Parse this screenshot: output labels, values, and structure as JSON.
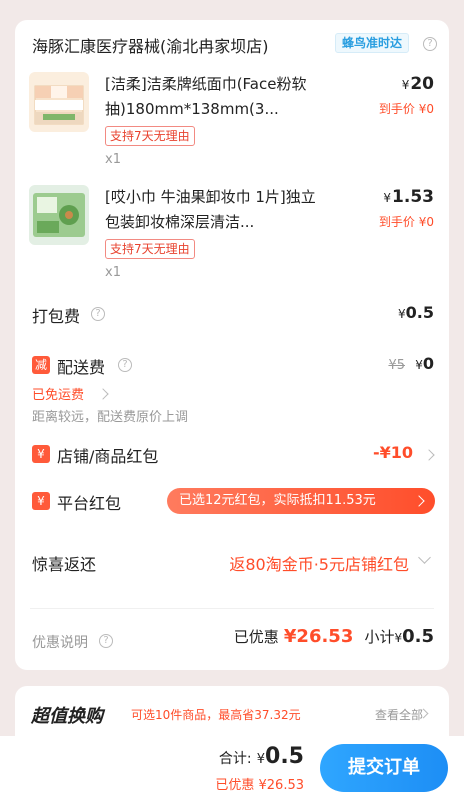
{
  "store": {
    "name": "海豚汇康医疗器械(渝北冉家坝店)",
    "delivery_badge": "蜂鸟准时达"
  },
  "items": [
    {
      "title": "[洁柔]洁柔牌纸面巾(Face粉软抽)180mm*138mm(3...",
      "tag": "支持7天无理由",
      "qty": "x1",
      "price_symbol": "¥",
      "price": "20",
      "final_label": "到手价 ¥0"
    },
    {
      "title": "[哎小巾 牛油果卸妆巾 1片]独立包装卸妆棉深层清洁...",
      "tag": "支持7天无理由",
      "qty": "x1",
      "price_symbol": "¥",
      "price": "1.53",
      "final_label": "到手价 ¥0"
    }
  ],
  "packing": {
    "label": "打包费",
    "symbol": "¥",
    "value": "0.5"
  },
  "delivery": {
    "badge": "减",
    "label": "配送费",
    "original": "¥5",
    "symbol": "¥",
    "value": "0",
    "free_text": "已免运费",
    "note": "距离较远，配送费原价上调"
  },
  "store_coupon": {
    "badge": "¥",
    "label": "店铺/商品红包",
    "value": "-¥10"
  },
  "platform_coupon": {
    "badge": "¥",
    "label": "平台红包",
    "pill_text": "已选12元红包，实际抵扣11.53元"
  },
  "surprise": {
    "label": "惊喜返还",
    "value": "返80淘金币·5元店铺红包"
  },
  "summary": {
    "label": "优惠说明",
    "discount_label": "已优惠",
    "discount_value": "¥26.53",
    "subtotal_label": "小计",
    "subtotal_symbol": "¥",
    "subtotal_value": "0.5"
  },
  "deal_banner": {
    "title": "超值换购",
    "subtitle": "可选10件商品，最高省37.32元",
    "link": "查看全部"
  },
  "footer": {
    "total_label": "合计:",
    "total_symbol": "¥",
    "total_value": "0.5",
    "discount_text": "已优惠 ¥26.53",
    "submit_label": "提交订单"
  },
  "colors": {
    "accent_red": "#ff4d2a",
    "accent_blue": "#1d8ef5",
    "badge_blue": "#2a9ee0"
  }
}
